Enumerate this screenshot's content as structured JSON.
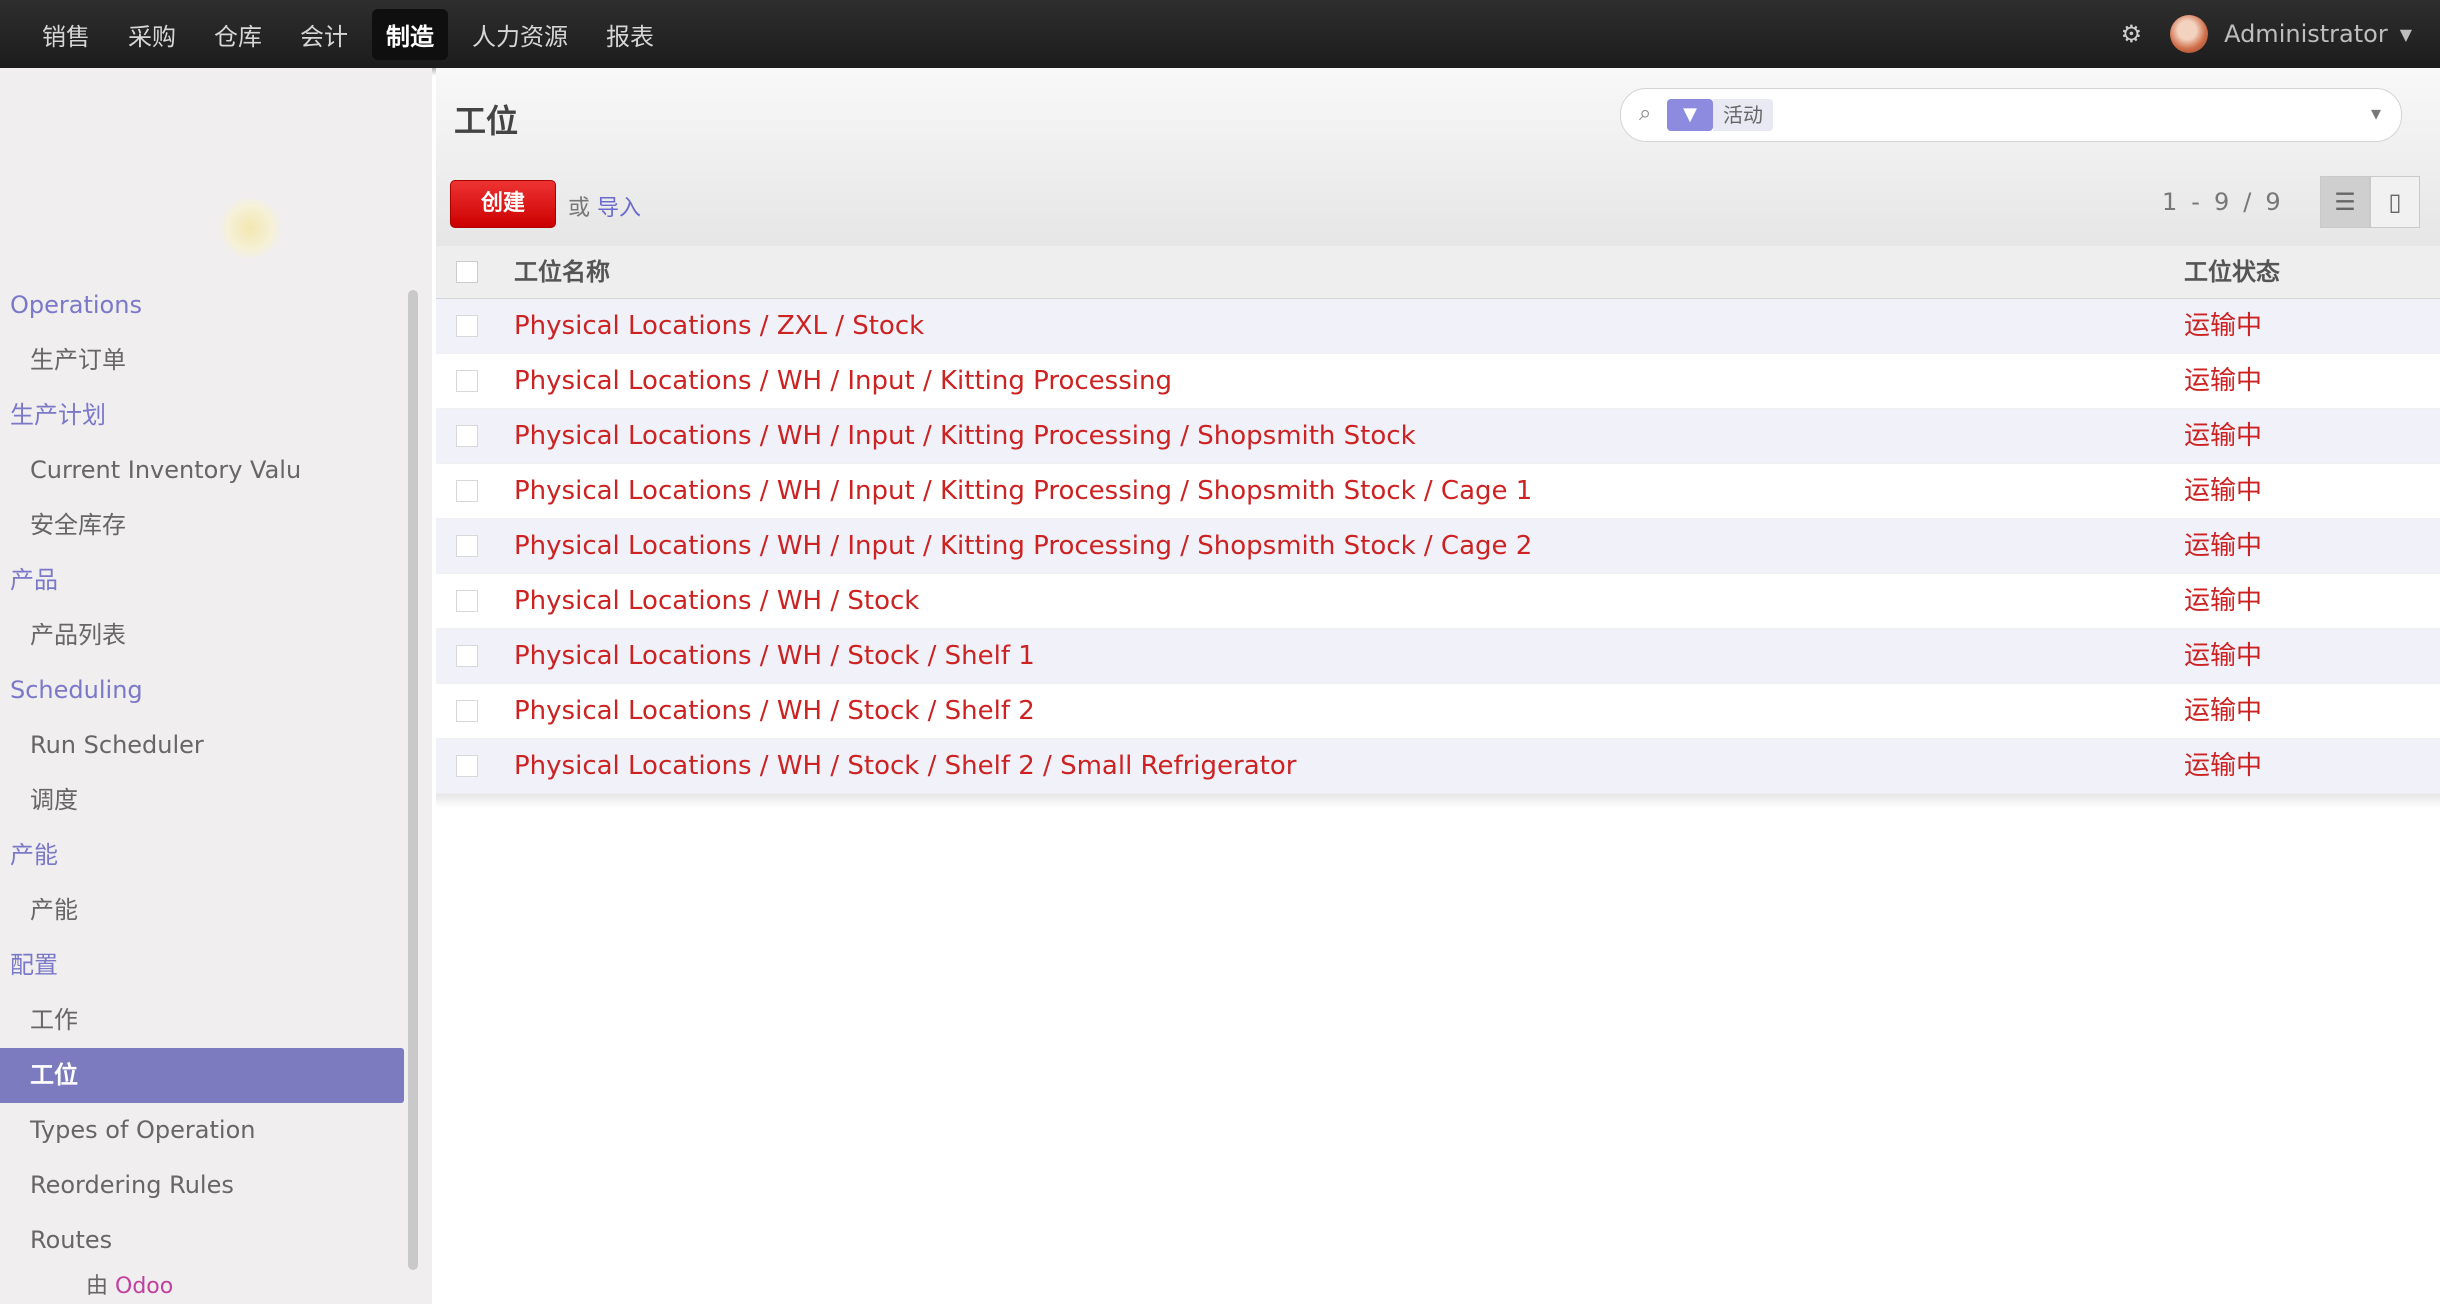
{
  "topbar": {
    "menu": [
      "销售",
      "采购",
      "仓库",
      "会计",
      "制造",
      "人力资源",
      "报表"
    ],
    "active_index": 4,
    "system_icon": "settings-icon",
    "user_name": "Administrator"
  },
  "sidebar": {
    "sections": [
      {
        "title": "Operations",
        "items": [
          "生产订单"
        ]
      },
      {
        "title": "生产计划",
        "items": [
          "Current Inventory Valu",
          "安全库存"
        ]
      },
      {
        "title": "产品",
        "items": [
          "产品列表"
        ]
      },
      {
        "title": "Scheduling",
        "items": [
          "Run Scheduler",
          "调度"
        ]
      },
      {
        "title": "产能",
        "items": [
          "产能"
        ]
      },
      {
        "title": "配置",
        "items": [
          "工作",
          "工位",
          "Types of Operation",
          "Reordering Rules",
          "Routes"
        ]
      }
    ],
    "active_item": "工位",
    "powered_by_prefix": "由",
    "powered_by_brand": "Odoo"
  },
  "main": {
    "title": "工位",
    "search": {
      "facet_icon": "filter-icon",
      "facet_label": "活动",
      "placeholder": ""
    },
    "create_label": "创建",
    "import_prefix": "或",
    "import_label": "导入",
    "pager": [
      "1",
      "-",
      "9",
      "/",
      "9"
    ],
    "columns": [
      "工位名称",
      "工位状态"
    ],
    "rows": [
      {
        "name": "Physical Locations / ZXL / Stock",
        "status": "运输中"
      },
      {
        "name": "Physical Locations / WH / Input / Kitting Processing",
        "status": "运输中"
      },
      {
        "name": "Physical Locations / WH / Input / Kitting Processing / Shopsmith Stock",
        "status": "运输中"
      },
      {
        "name": "Physical Locations / WH / Input / Kitting Processing / Shopsmith Stock / Cage 1",
        "status": "运输中"
      },
      {
        "name": "Physical Locations / WH / Input / Kitting Processing / Shopsmith Stock / Cage 2",
        "status": "运输中"
      },
      {
        "name": "Physical Locations / WH / Stock",
        "status": "运输中"
      },
      {
        "name": "Physical Locations / WH / Stock / Shelf 1",
        "status": "运输中"
      },
      {
        "name": "Physical Locations / WH / Stock / Shelf 2",
        "status": "运输中"
      },
      {
        "name": "Physical Locations / WH / Stock / Shelf 2 / Small Refrigerator",
        "status": "运输中"
      }
    ]
  },
  "colors": {
    "accent": "#7c7bbf",
    "create_button": "#dd1111",
    "row_text": "#cc2222",
    "topbar": "#222222"
  }
}
